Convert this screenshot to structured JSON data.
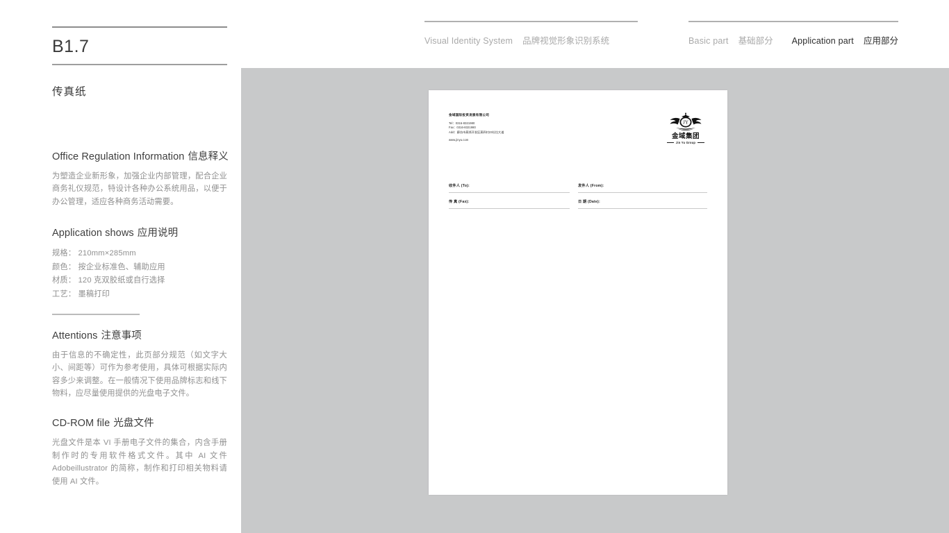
{
  "topnav": {
    "visual_identity": {
      "en": "Visual Identity System",
      "cn": "品牌视觉形象识别系统"
    },
    "basic_part": {
      "en": "Basic part",
      "cn": "基础部分"
    },
    "application_part": {
      "en": "Application part",
      "cn": "应用部分"
    }
  },
  "sidebar": {
    "page_code": "B1.7",
    "page_title_cn": "传真纸",
    "sections": [
      {
        "head_en": "Office Regulation Information",
        "head_cn": "信息释义",
        "body": "为塑造企业新形象，加强企业内部管理，配合企业商务礼仪规范，特设计各种办公系统用品，以便于办公管理，适应各种商务活动需要。"
      },
      {
        "head_en": "Application shows",
        "head_cn": "应用说明",
        "specs": [
          "规格： 210mm×285mm",
          "颜色： 按企业标准色、辅助应用",
          "材质： 120 克双胶纸或自行选择",
          "工艺： 墨稿打印"
        ]
      },
      {
        "head_en": "Attentions",
        "head_cn": "注意事项",
        "body": "由于信息的不确定性，此页部分规范（如文字大小、间距等）可作为参考使用，具体可根据实际内容多少来调整。在一般情况下使用品牌标志和线下物料，应尽量使用提供的光盘电子文件。"
      },
      {
        "head_en": "CD-ROM file",
        "head_cn": "光盘文件",
        "body": "光盘文件是本 VI 手册电子文件的集合，内含手册制作时的专用软件格式文件。其中 AI 文件 Adobeillustrator 的简称，制作和打印相关物料请使用 AI 文件。"
      }
    ]
  },
  "fax_sheet": {
    "company_name": "金域国际投资发展有限公司",
    "contact": {
      "tel": "Tel：0316-8321980",
      "fax": "Fax：0316-8321980",
      "add": "Add：廊坊市燕郊开发区燕四村23社拉大道",
      "web": "www.jinyu.com"
    },
    "logo": {
      "monogram": "JY",
      "cn": "金域集团",
      "en": "Jin Yu Group"
    },
    "form_fields": [
      {
        "label": "收件人 (To):"
      },
      {
        "label": "发件人 (From):"
      },
      {
        "label": "传  真 (Fax):"
      },
      {
        "label": "日  期 (Date):"
      }
    ]
  },
  "colors": {
    "panel_gray": "#c8c9ca",
    "rule_gray": "#8c8c8c",
    "muted_text": "#8f8f8f",
    "active_text": "#2b2b2b",
    "inactive_text": "#a9a9a9"
  }
}
